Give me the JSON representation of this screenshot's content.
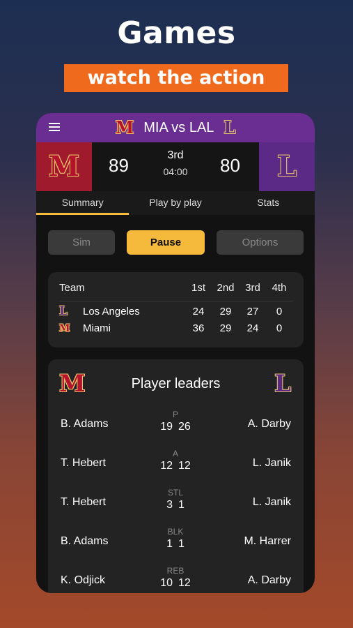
{
  "hero": {
    "title": "Games",
    "subtitle": "watch the action"
  },
  "topbar": {
    "title": "MIA vs LAL",
    "home_logo": "M",
    "away_logo": "L"
  },
  "scoreboard": {
    "home_score": "89",
    "away_score": "80",
    "period": "3rd",
    "clock": "04:00"
  },
  "tabs": [
    {
      "label": "Summary",
      "active": true
    },
    {
      "label": "Play by play",
      "active": false
    },
    {
      "label": "Stats",
      "active": false
    }
  ],
  "controls": {
    "sim": "Sim",
    "pause": "Pause",
    "options": "Options"
  },
  "quarters": {
    "headers": [
      "Team",
      "1st",
      "2nd",
      "3rd",
      "4th"
    ],
    "rows": [
      {
        "logo": "L",
        "team": "Los Angeles",
        "scores": [
          "24",
          "29",
          "27",
          "0"
        ]
      },
      {
        "logo": "M",
        "team": "Miami",
        "scores": [
          "36",
          "29",
          "24",
          "0"
        ]
      }
    ]
  },
  "leaders": {
    "title": "Player leaders",
    "rows": [
      {
        "home_player": "B. Adams",
        "stat": "P",
        "home_val": "19",
        "away_val": "26",
        "away_player": "A. Darby"
      },
      {
        "home_player": "T. Hebert",
        "stat": "A",
        "home_val": "12",
        "away_val": "12",
        "away_player": "L. Janik"
      },
      {
        "home_player": "T. Hebert",
        "stat": "STL",
        "home_val": "3",
        "away_val": "1",
        "away_player": "L. Janik"
      },
      {
        "home_player": "B. Adams",
        "stat": "BLK",
        "home_val": "1",
        "away_val": "1",
        "away_player": "M. Harrer"
      },
      {
        "home_player": "K. Odjick",
        "stat": "REB",
        "home_val": "10",
        "away_val": "12",
        "away_player": "A. Darby"
      }
    ]
  },
  "colors": {
    "accent": "#f5b93b",
    "miami": "#a01a2e",
    "lakers": "#5a2a86",
    "banner": "#f06a1e"
  }
}
